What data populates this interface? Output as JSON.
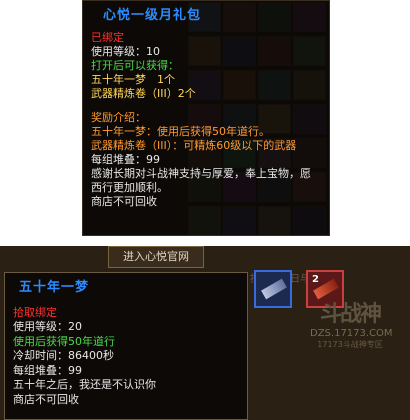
{
  "top_tooltip": {
    "title": "心悦一级月礼包",
    "bind_status": "已绑定",
    "use_level": "使用等级：10",
    "open_header": "打开后可以获得：",
    "contents": [
      "五十年一梦　1个",
      "武器精炼卷（III）2个"
    ],
    "reward_header": "奖励介绍：",
    "rewards": [
      "五十年一梦：使用后获得50年道行。",
      "武器精炼卷（III）：可精炼60级以下的武器"
    ],
    "stack": "每组堆叠：99",
    "description": "感谢长期对斗战神支持与厚爱，奉上宝物，愿西行更加顺利。",
    "shop": "商店不可回收"
  },
  "bottom": {
    "banner": "进入心悦官网",
    "background_text": "按照自然日与",
    "slot2_count": "2",
    "watermark_main": "斗战神",
    "watermark_url": "DZS.17173.COM",
    "watermark_sub": "17173斗战神专区"
  },
  "bottom_tooltip": {
    "title": "五十年一梦",
    "bind_status": "拾取绑定",
    "use_level": "使用等级：20",
    "effect": "使用后获得50年道行",
    "cooldown": "冷却时间：86400秒",
    "stack": "每组堆叠：99",
    "description": "五十年之后，我还是不认识你",
    "shop": "商店不可回收"
  }
}
